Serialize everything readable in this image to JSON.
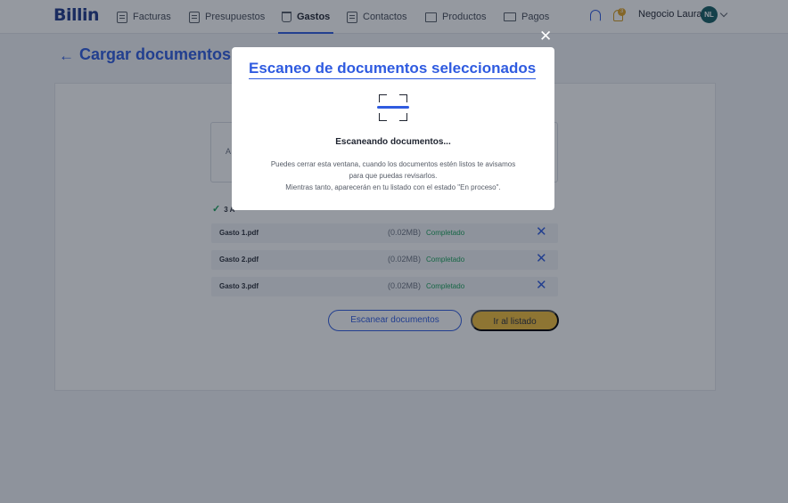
{
  "brand": {
    "logo": "Billin"
  },
  "nav": {
    "items": [
      {
        "label": "Facturas"
      },
      {
        "label": "Presupuestos"
      },
      {
        "label": "Gastos"
      },
      {
        "label": "Contactos"
      },
      {
        "label": "Productos"
      },
      {
        "label": "Pagos"
      }
    ],
    "notification_count": "3",
    "user_name": "Negocio Laura",
    "user_initials": "NL"
  },
  "page": {
    "title": "Cargar documentos",
    "dropzone_text": "A",
    "files_summary": "3 A",
    "files": [
      {
        "name": "Gasto 1.pdf",
        "size": "(0.02MB)",
        "status": "Completado"
      },
      {
        "name": "Gasto 2.pdf",
        "size": "(0.02MB)",
        "status": "Completado"
      },
      {
        "name": "Gasto 3.pdf",
        "size": "(0.02MB)",
        "status": "Completado"
      }
    ],
    "scan_button": "Escanear documentos",
    "list_button": "Ir al listado"
  },
  "modal": {
    "title": "Escaneo de documentos seleccionados",
    "heading": "Escaneando documentos...",
    "body_line1": "Puedes cerrar esta ventana, cuando los documentos estén listos te avisamos",
    "body_line2": "para que puedas revisarlos.",
    "body_line3": "Mientras tanto, aparecerán en tu listado con el estado \"En proceso\"."
  },
  "colors": {
    "accent": "#2f5be0",
    "success": "#1aa35b",
    "warning": "#f2bd3a"
  }
}
